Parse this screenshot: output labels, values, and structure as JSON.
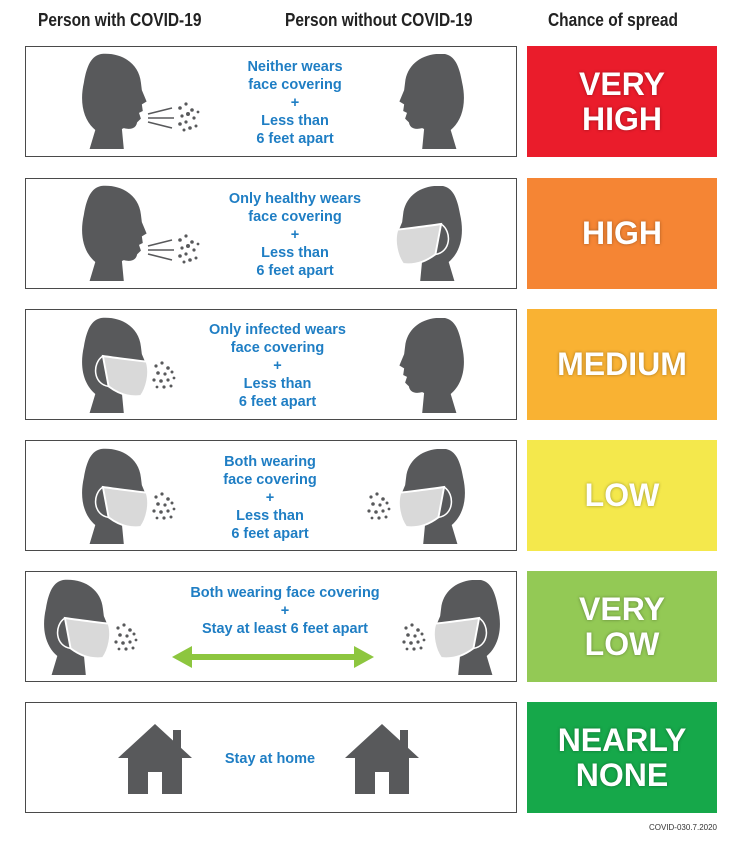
{
  "headers": {
    "col1": "Person with COVID-19",
    "col2": "Person without COVID-19",
    "col3": "Chance of spread"
  },
  "rows": [
    {
      "scenario": [
        "Neither wears",
        "face covering",
        "+",
        "Less than",
        "6 feet apart"
      ],
      "risk": [
        "VERY",
        "HIGH"
      ],
      "risk_color": "#ea1c2b",
      "left_figure": "unmasked-head-icon",
      "right_figure": "unmasked-head-icon",
      "spray": "exhale-droplets-icon"
    },
    {
      "scenario": [
        "Only healthy wears",
        "face covering",
        "+",
        "Less than",
        "6 feet apart"
      ],
      "risk": [
        "HIGH"
      ],
      "risk_color": "#f58534",
      "left_figure": "unmasked-head-icon",
      "right_figure": "masked-head-icon",
      "spray": "exhale-droplets-icon"
    },
    {
      "scenario": [
        "Only infected wears",
        "face covering",
        "+",
        "Less than",
        "6 feet apart"
      ],
      "risk": [
        "MEDIUM"
      ],
      "risk_color": "#f9b233",
      "left_figure": "masked-head-icon",
      "right_figure": "unmasked-head-icon",
      "spray": "droplets-icon"
    },
    {
      "scenario": [
        "Both wearing",
        "face covering",
        "+",
        "Less than",
        "6 feet apart"
      ],
      "risk": [
        "LOW"
      ],
      "risk_color": "#f4e84c",
      "left_figure": "masked-head-icon",
      "right_figure": "masked-head-icon",
      "spray": "droplets-icon"
    },
    {
      "scenario": [
        "Both wearing face covering",
        "+",
        "Stay at least 6 feet apart"
      ],
      "risk": [
        "VERY",
        "LOW"
      ],
      "risk_color": "#93c955",
      "left_figure": "masked-head-icon",
      "right_figure": "masked-head-icon",
      "spray": "droplets-icon",
      "distance_arrow": "double-arrow-icon",
      "arrow_color": "#8dc63f"
    },
    {
      "scenario": [
        "Stay at home"
      ],
      "risk": [
        "NEARLY",
        "NONE"
      ],
      "risk_color": "#16a84a",
      "left_figure": "house-icon",
      "right_figure": "house-icon"
    }
  ],
  "colors": {
    "scenario_text": "#1f7ec4",
    "figure": "#58595b",
    "mask": "#d9d9d9"
  },
  "footer": "COVID-030.7.2020"
}
